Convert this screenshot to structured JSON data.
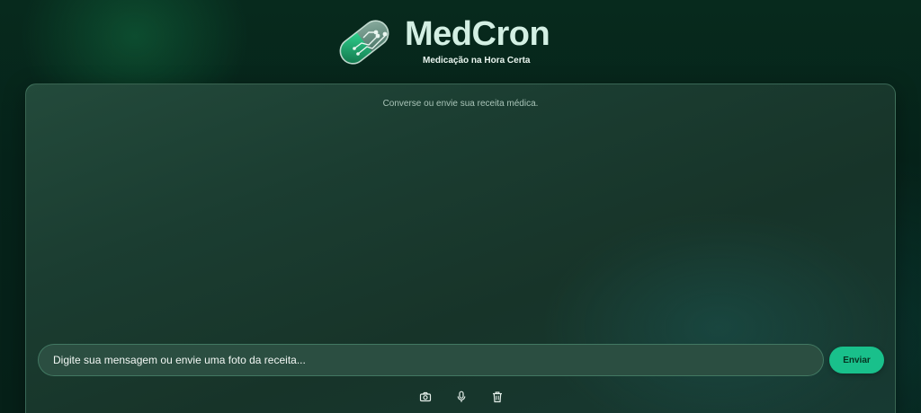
{
  "brand": {
    "title": "MedCron",
    "subtitle": "Medicação na Hora Certa",
    "logo_icon": "capsule-circuit-icon"
  },
  "chat": {
    "hint": "Converse ou envie sua receita médica.",
    "input": {
      "placeholder": "Digite sua mensagem ou envie uma foto da receita...",
      "value": ""
    },
    "send_label": "Enviar",
    "actions": [
      {
        "icon": "camera-icon"
      },
      {
        "icon": "microphone-icon"
      },
      {
        "icon": "trash-icon"
      }
    ]
  },
  "colors": {
    "accent": "#19c08b",
    "background": "#062018",
    "card": "#1b3d31",
    "brand_text": "#d3efe3"
  }
}
